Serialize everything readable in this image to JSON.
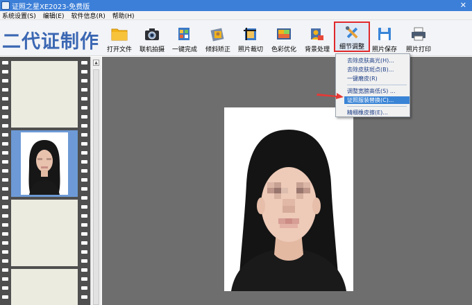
{
  "window": {
    "title": "证照之星XE2023-免费版",
    "close_glyph": "✕",
    "app_icon": "app-icon"
  },
  "menu": [
    {
      "label": "系统设置(S)"
    },
    {
      "label": "编辑(E)"
    },
    {
      "label": "软件信息(R)"
    },
    {
      "label": "帮助(H)"
    }
  ],
  "logo": {
    "text": "二代证制作",
    "color": "#3b67b3"
  },
  "toolbar": {
    "buttons": [
      {
        "label": "打开文件",
        "icon": "folder-icon"
      },
      {
        "label": "联机拍摄",
        "icon": "camera-icon"
      },
      {
        "label": "一键完成",
        "icon": "film-icon"
      },
      {
        "label": "倾斜矫正",
        "icon": "tilt-correction-icon"
      },
      {
        "label": "照片裁切",
        "icon": "crop-icon"
      },
      {
        "label": "色彩优化",
        "icon": "color-optimize-icon"
      },
      {
        "label": "背景处理",
        "icon": "background-icon"
      },
      {
        "label": "细节调整",
        "icon": "detail-adjust-icon",
        "active": true
      },
      {
        "label": "照片保存",
        "icon": "save-icon"
      },
      {
        "label": "照片打印",
        "icon": "print-icon"
      }
    ]
  },
  "detail_menu": {
    "items": [
      {
        "label": "去除皮肤高光(H)..."
      },
      {
        "label": "去除皮肤斑点(B)..."
      },
      {
        "label": "一键磨皮(R)"
      },
      {
        "label": "调整宽膀高低(S) ..."
      },
      {
        "label": "证照服装替换(C)...",
        "highlighted": true
      },
      {
        "label": "精细橡皮擦(E)..."
      }
    ]
  },
  "colors": {
    "title_bar": "#3c7fd8",
    "highlight_border": "#e0282a",
    "menu_highlight": "#3a84d6",
    "arrow": "#e53935",
    "film_strip": "#4f4f4f",
    "selected_frame": "#6d9ad6",
    "canvas": "#6e6e6e"
  }
}
